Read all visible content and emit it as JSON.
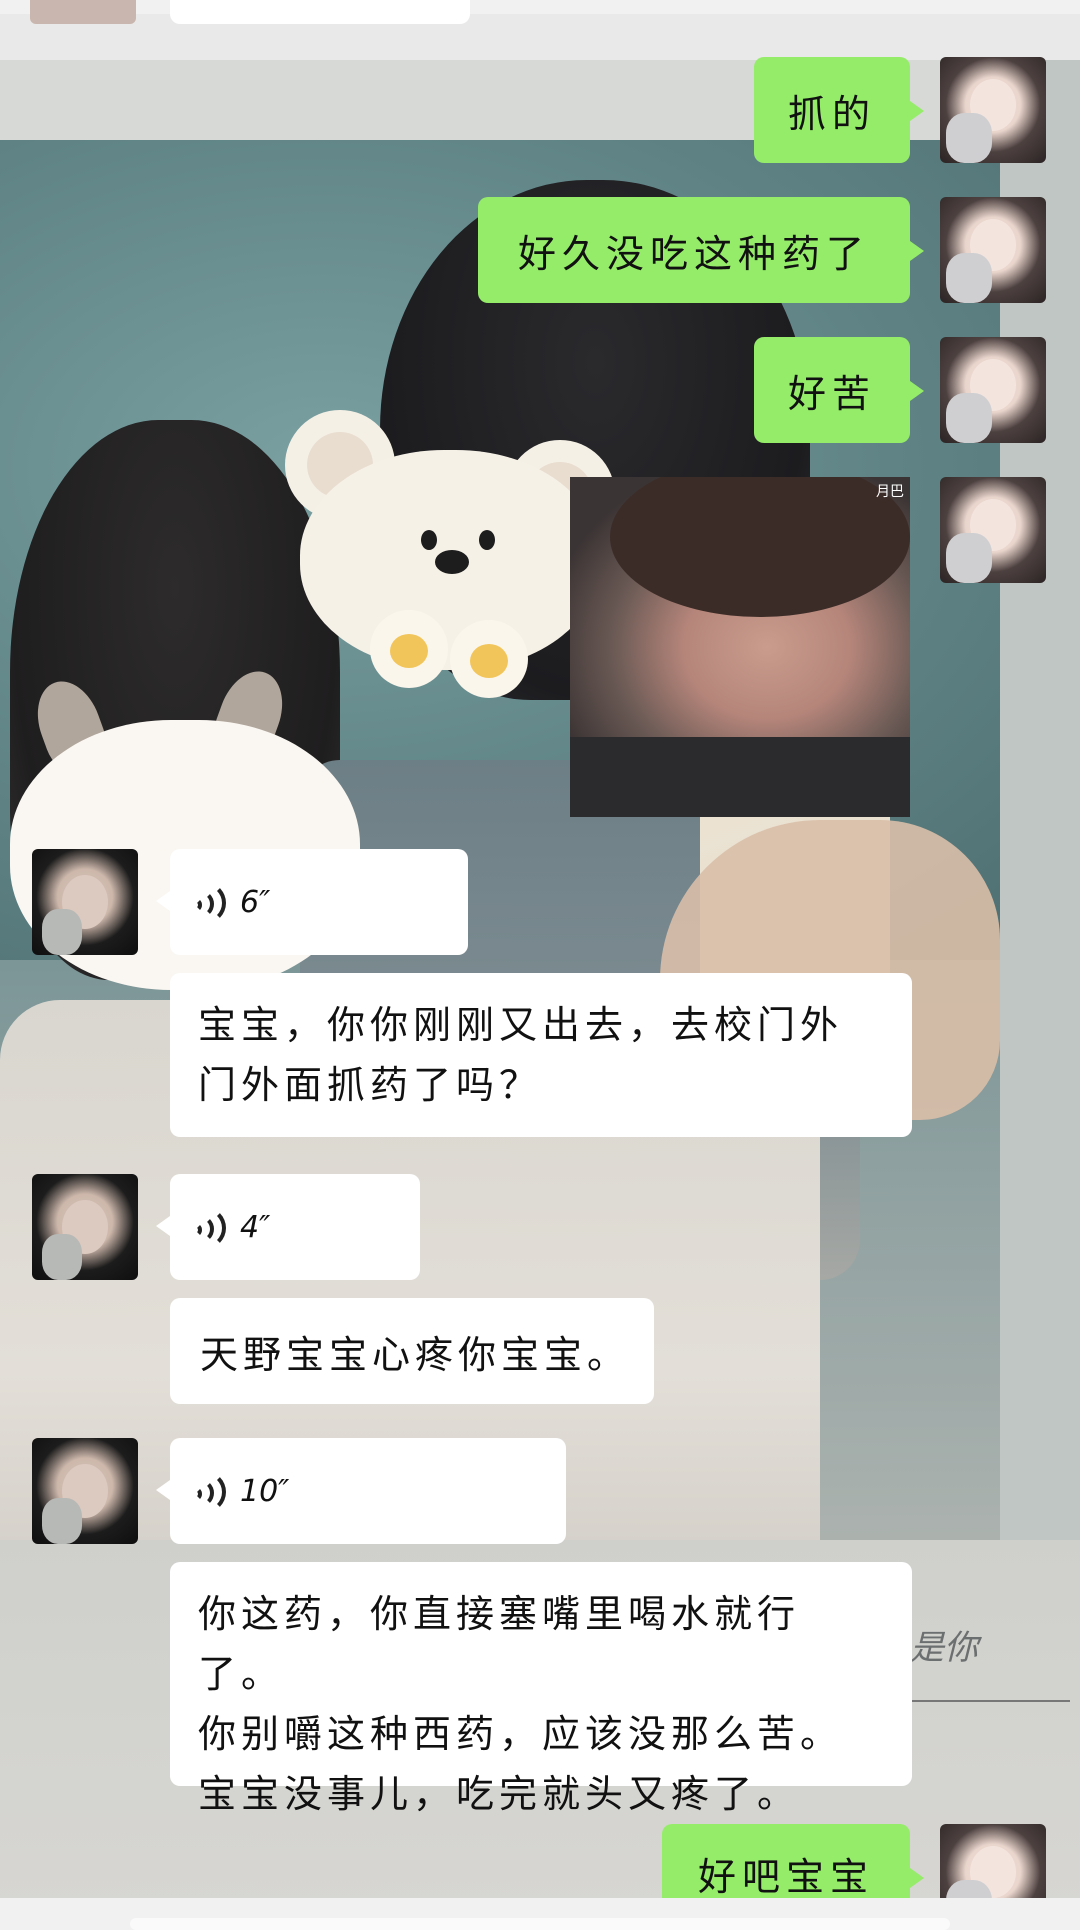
{
  "chat": {
    "messages": [
      {
        "id": "m1",
        "from": "me",
        "type": "text",
        "text": "抓的"
      },
      {
        "id": "m2",
        "from": "me",
        "type": "text",
        "text": "好久没吃这种药了"
      },
      {
        "id": "m3",
        "from": "me",
        "type": "text",
        "text": "好苦"
      },
      {
        "id": "m4",
        "from": "me",
        "type": "sticker",
        "sticker_label": "月巴"
      },
      {
        "id": "m5",
        "from": "other",
        "type": "voice",
        "duration": "6″"
      },
      {
        "id": "m6",
        "from": "other",
        "type": "text",
        "lines": [
          "宝宝，你你刚刚又出去，去校门外",
          "门外面抓药了吗？"
        ]
      },
      {
        "id": "m7",
        "from": "other",
        "type": "voice",
        "duration": "4″"
      },
      {
        "id": "m8",
        "from": "other",
        "type": "text",
        "text": "天野宝宝心疼你宝宝。"
      },
      {
        "id": "m9",
        "from": "other",
        "type": "voice",
        "duration": "10″"
      },
      {
        "id": "m10",
        "from": "other",
        "type": "text",
        "lines": [
          "你这药，你直接塞嘴里喝水就行了。",
          "你别嚼这种西药，应该没那么苦。",
          "宝宝没事儿，吃完就头又疼了。"
        ]
      },
      {
        "id": "m11",
        "from": "me",
        "type": "text",
        "text": "好吧宝宝"
      }
    ]
  },
  "background": {
    "handwritten_text": "是你"
  },
  "colors": {
    "outgoing_bubble": "#95ec69",
    "incoming_bubble": "#ffffff"
  },
  "icons": {
    "voice": "voice-wave-icon"
  }
}
